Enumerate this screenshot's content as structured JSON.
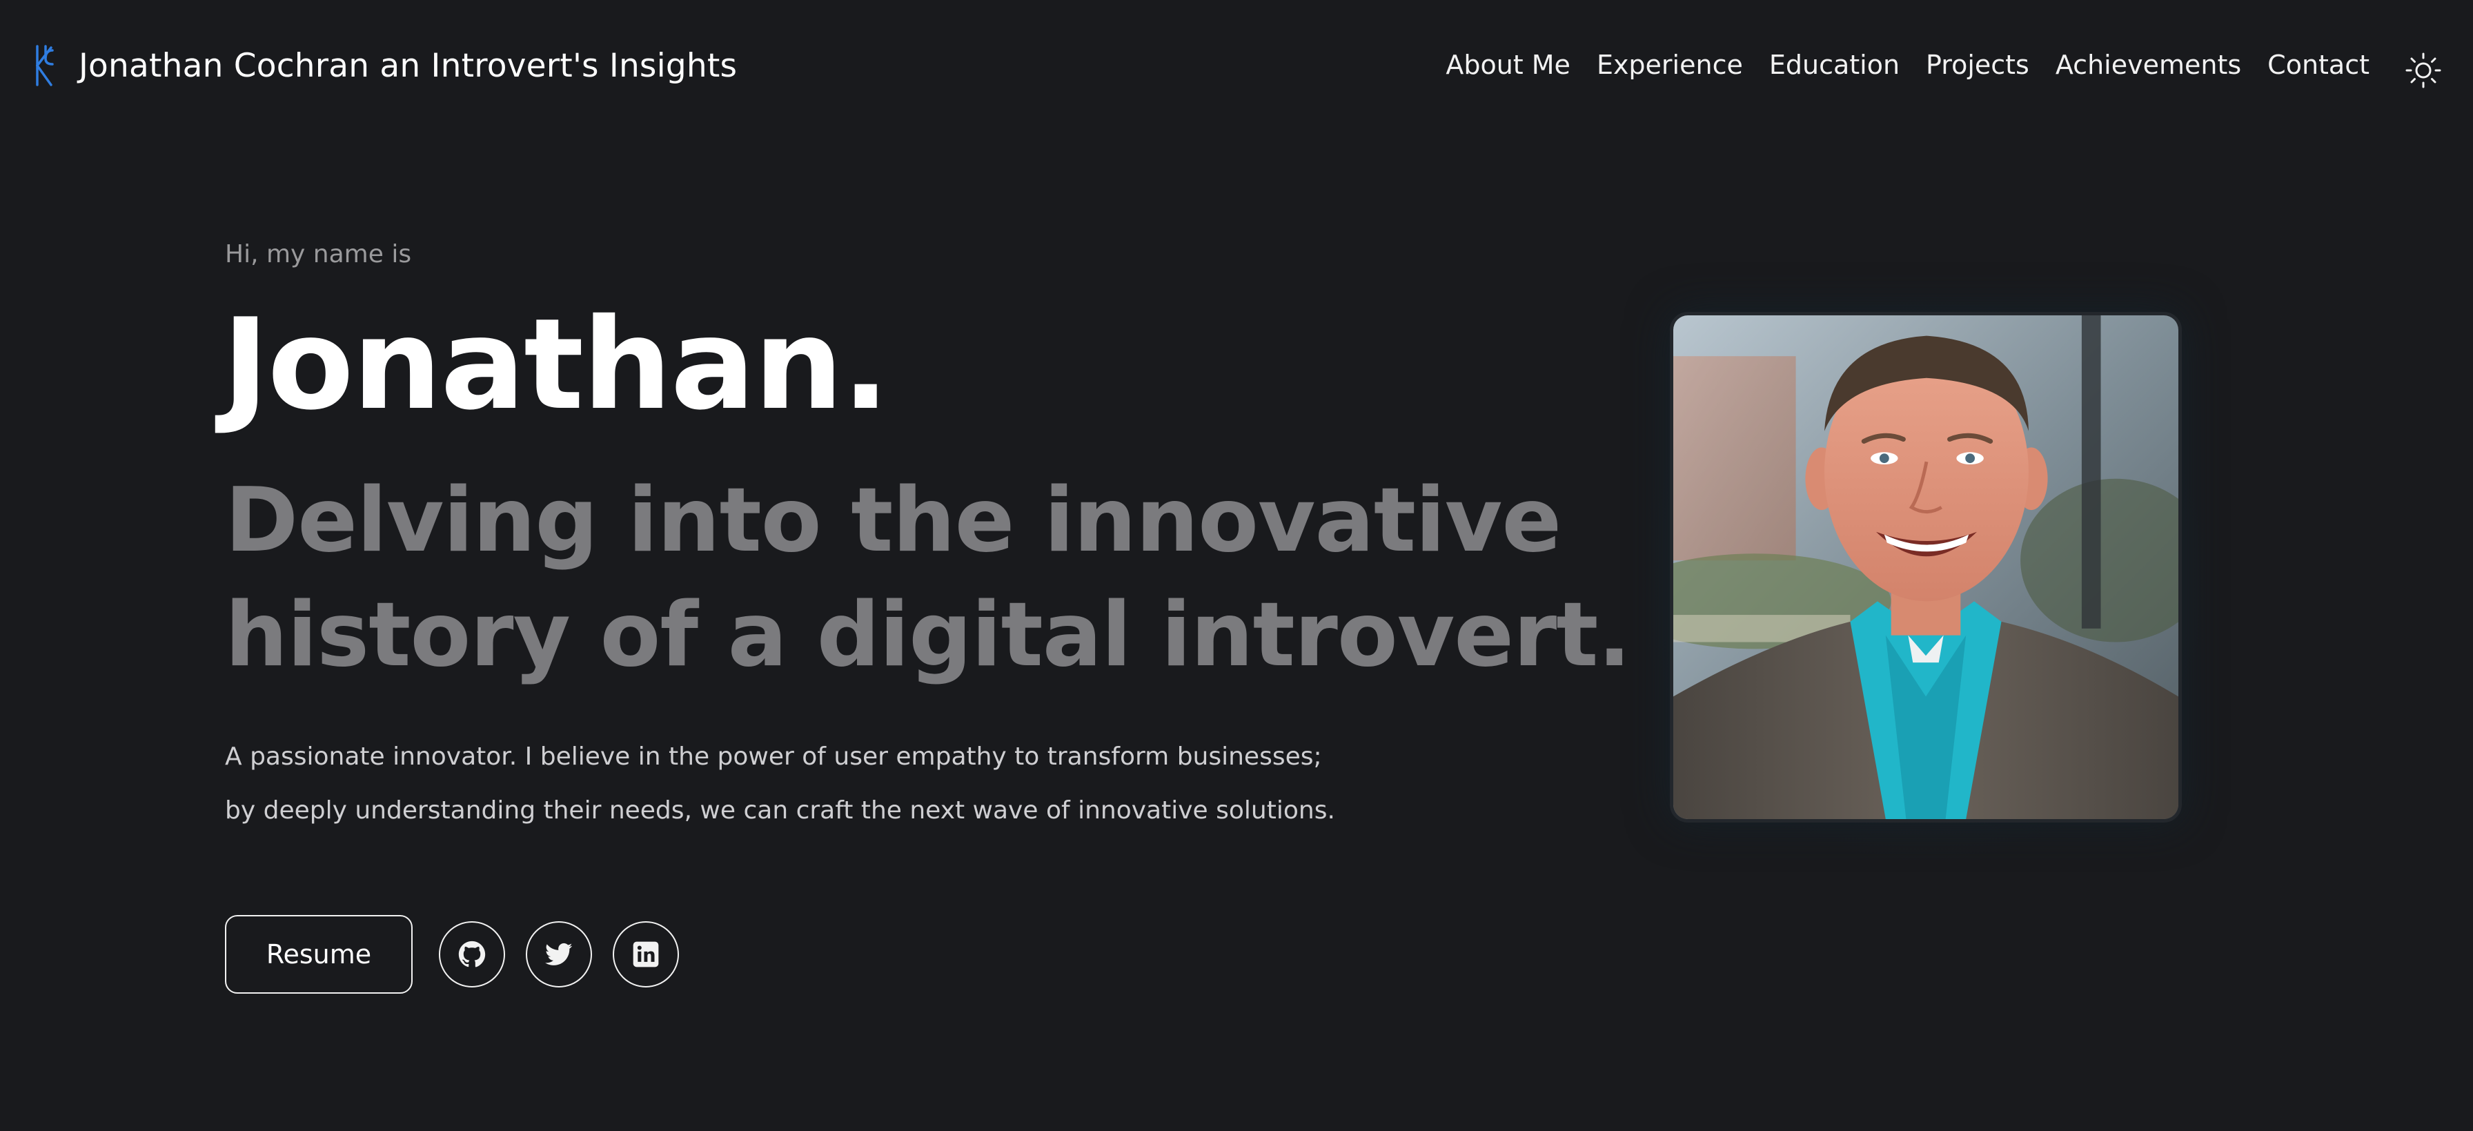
{
  "header": {
    "title": "Jonathan Cochran an Introvert's Insights",
    "logo_icon": "kc-monogram-icon",
    "accent_color": "#2f7de1",
    "nav": [
      {
        "label": "About Me"
      },
      {
        "label": "Experience"
      },
      {
        "label": "Education"
      },
      {
        "label": "Projects"
      },
      {
        "label": "Achievements"
      },
      {
        "label": "Contact"
      }
    ],
    "theme_toggle_icon": "sun-icon"
  },
  "hero": {
    "intro": "Hi, my name is",
    "name": "Jonathan.",
    "tagline_line1": "Delving into the innovative",
    "tagline_line2": "history of a digital introvert.",
    "description_line1": "A passionate innovator. I believe in the power of user empathy to transform businesses;",
    "description_line2": "by deeply understanding their needs, we can craft the next wave of innovative solutions.",
    "resume_label": "Resume",
    "social": [
      {
        "icon": "github-icon"
      },
      {
        "icon": "twitter-icon"
      },
      {
        "icon": "linkedin-icon"
      }
    ]
  },
  "profile_photo": {
    "icon": "profile-photo",
    "colors": {
      "shirt": "#21b6c9",
      "jacket": "#5a534c",
      "background": "#8a9aa6"
    }
  }
}
